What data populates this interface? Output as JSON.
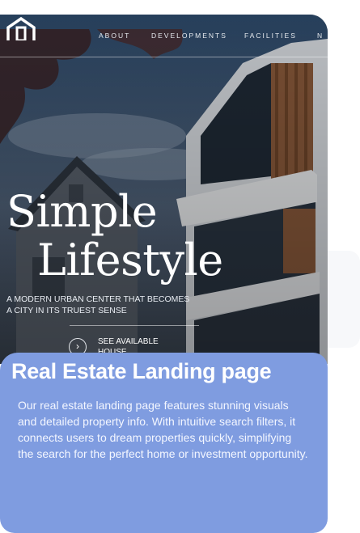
{
  "nav": {
    "items": [
      "ABOUT",
      "DEVELOPMENTS",
      "FACILITIES",
      "N"
    ]
  },
  "hero": {
    "title_line1": "Simple",
    "title_line2": "Lifestyle",
    "tagline": "A MODERN URBAN CENTER THAT BECOMES A CITY IN ITS TRUEST SENSE",
    "cta_label": "SEE AVAILABLE HOUSE",
    "cta_icon": "chevron-right-icon"
  },
  "card": {
    "title": "Real Estate Landing page",
    "description": "Our real estate landing page features stunning visuals and detailed property info. With intuitive search filters, it connects users to dream properties quickly, simplifying the search for the perfect home or investment opportunity."
  },
  "colors": {
    "card_background": "#7f9ce0",
    "text_light": "#ffffff"
  }
}
